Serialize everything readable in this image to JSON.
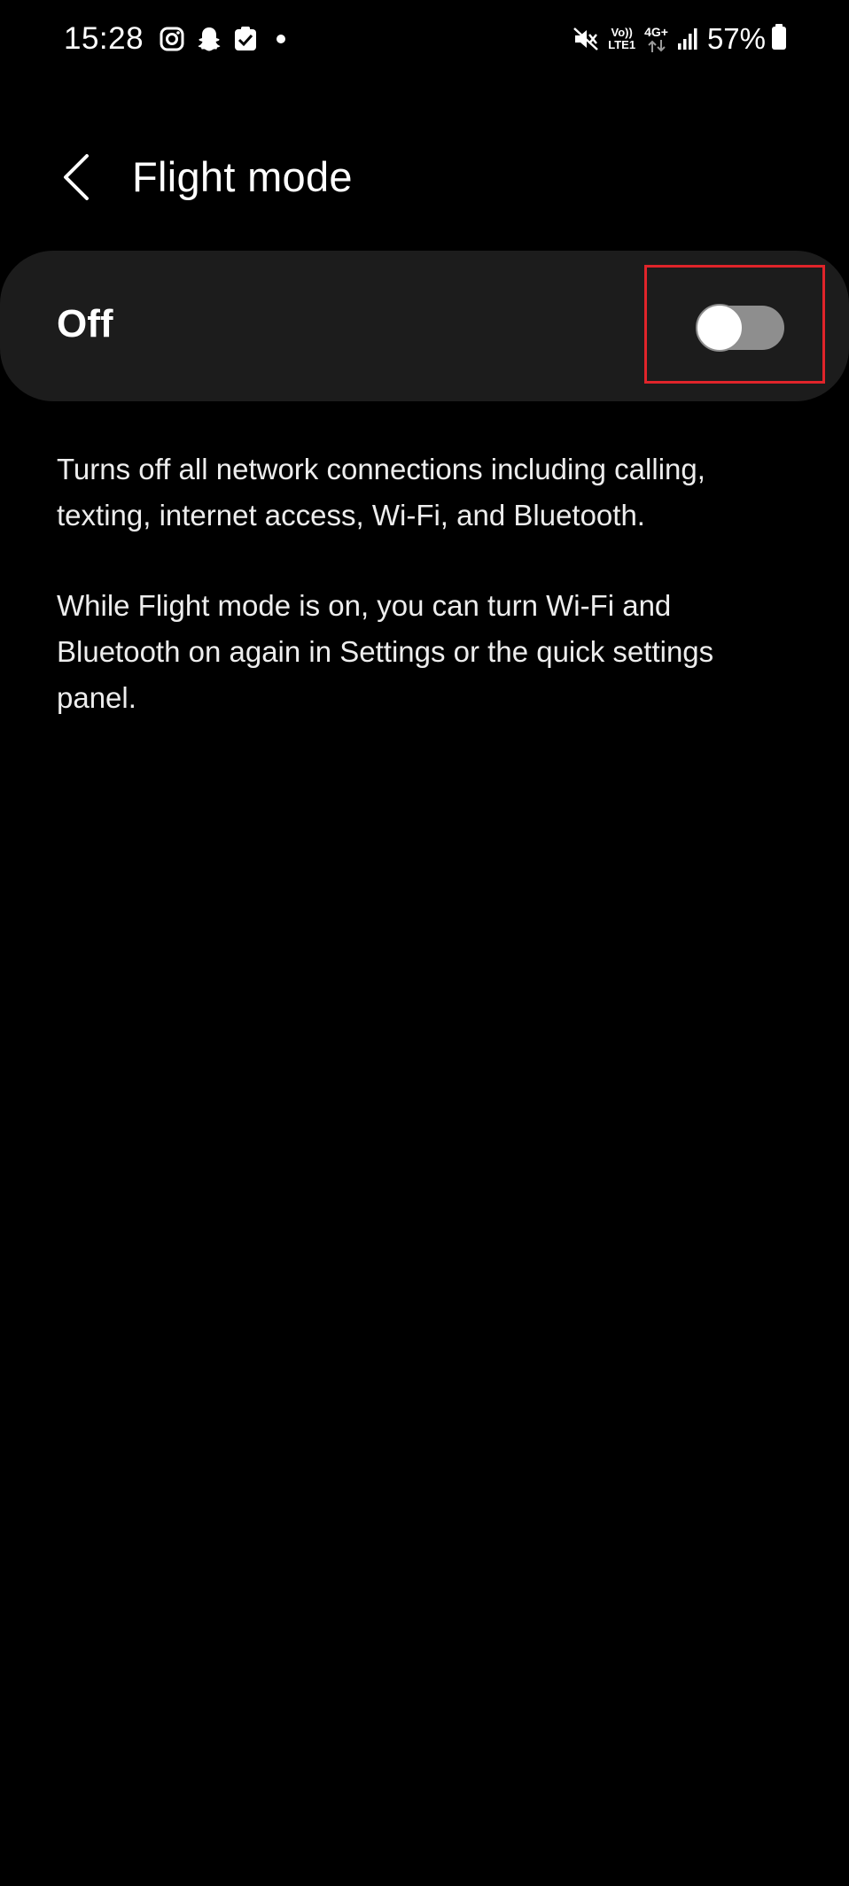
{
  "status_bar": {
    "time": "15:28",
    "left_icons": [
      "instagram-icon",
      "snapchat-icon",
      "task-check-icon",
      "notification-dot"
    ],
    "volte_top": "Vo))",
    "volte_bottom": "LTE1",
    "network_type": "4G+",
    "battery_percent": "57%"
  },
  "header": {
    "title": "Flight mode",
    "back_icon": "chevron-left-icon"
  },
  "toggle": {
    "label": "Off",
    "state": "off",
    "track_color": "#8e8e8e",
    "highlight_color": "#e0242a"
  },
  "description": {
    "paragraph1": "Turns off all network connections including calling, texting, internet access, Wi-Fi, and Bluetooth.",
    "paragraph2": "While Flight mode is on, you can turn Wi-Fi and Bluetooth on again in Settings or the quick settings panel."
  }
}
